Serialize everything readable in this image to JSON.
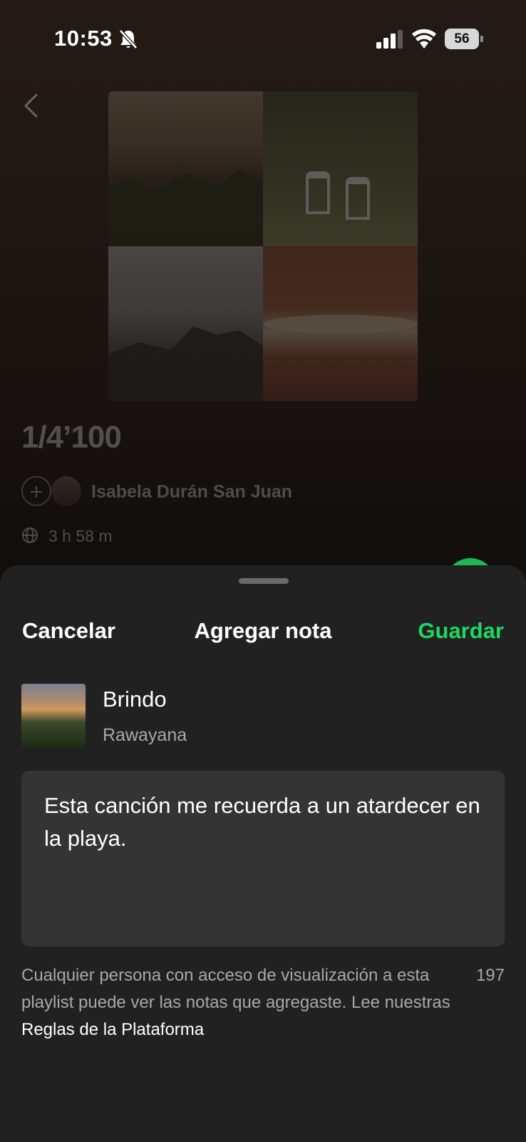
{
  "status_bar": {
    "time": "10:53",
    "battery": "56",
    "icons": [
      "bell-slash-icon",
      "cellular-signal-icon",
      "wifi-icon",
      "battery-icon"
    ]
  },
  "playlist": {
    "title": "1/4’100",
    "owner": "Isabela Durán San Juan",
    "duration": "3 h 58 m"
  },
  "sheet": {
    "cancel_label": "Cancelar",
    "title": "Agregar nota",
    "save_label": "Guardar",
    "track": {
      "title": "Brindo",
      "artist": "Rawayana"
    },
    "note_text": "Esta canción me recuerda a un atardecer en la playa.",
    "disclaimer_text": "Cualquier persona con acceso de visualización a esta playlist puede ver las notas que agregaste. Lee nuestras",
    "rules_link": "Reglas de la Plataforma",
    "char_counter": "197"
  },
  "colors": {
    "accent_green": "#1ed760",
    "sheet_background": "#212121",
    "input_background": "#343434",
    "secondary_text": "#a7a7a7"
  }
}
